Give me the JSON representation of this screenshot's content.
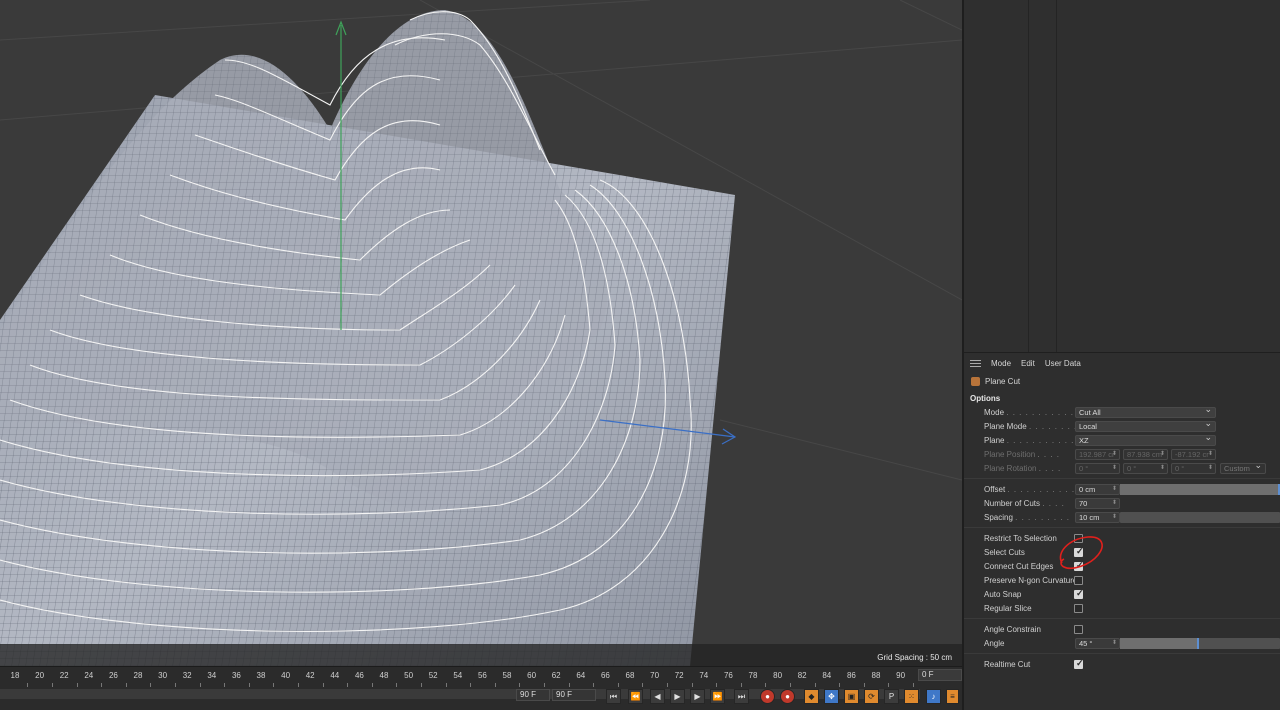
{
  "viewport": {
    "grid_spacing": "Grid Spacing : 50 cm"
  },
  "attributes": {
    "menu": [
      "Mode",
      "Edit",
      "User Data"
    ],
    "object_name": "Plane Cut",
    "section": "Options",
    "mode": {
      "label": "Mode",
      "value": "Cut All"
    },
    "plane_mode": {
      "label": "Plane Mode",
      "value": "Local"
    },
    "plane": {
      "label": "Plane",
      "value": "XZ"
    },
    "plane_position": {
      "label": "Plane Position",
      "values": [
        "192.987 cr",
        "87.938 cm",
        "-87.192 cr"
      ]
    },
    "plane_rotation": {
      "label": "Plane Rotation",
      "values": [
        "0 °",
        "0 °",
        "0 °"
      ],
      "mode": "Custom"
    },
    "offset": {
      "label": "Offset",
      "value": "0 cm",
      "slider": 0.99
    },
    "number_of_cuts": {
      "label": "Number of Cuts",
      "value": "70"
    },
    "spacing": {
      "label": "Spacing",
      "value": "10 cm",
      "slider": 0.0
    },
    "restrict_to_selection": {
      "label": "Restrict To Selection",
      "checked": false
    },
    "select_cuts": {
      "label": "Select Cuts",
      "checked": true
    },
    "connect_cut_edges": {
      "label": "Connect Cut Edges",
      "checked": true
    },
    "preserve_ngon": {
      "label": "Preserve N-gon Curvature",
      "checked": false
    },
    "auto_snap": {
      "label": "Auto Snap",
      "checked": true
    },
    "regular_slice": {
      "label": "Regular Slice",
      "checked": false
    },
    "angle_constrain": {
      "label": "Angle Constrain",
      "checked": false
    },
    "angle": {
      "label": "Angle",
      "value": "45 °",
      "slider": 0.5
    },
    "realtime_cut": {
      "label": "Realtime Cut",
      "checked": true
    }
  },
  "timeline": {
    "ticks": [
      "18",
      "20",
      "22",
      "24",
      "26",
      "28",
      "30",
      "32",
      "34",
      "36",
      "38",
      "40",
      "42",
      "44",
      "46",
      "48",
      "50",
      "52",
      "54",
      "56",
      "58",
      "60",
      "62",
      "64",
      "66",
      "68",
      "70",
      "72",
      "74",
      "76",
      "78",
      "80",
      "82",
      "84",
      "86",
      "88",
      "90"
    ],
    "current_frame": "0 F",
    "end_frame": "90 F",
    "end_frame_2": "90 F"
  },
  "colors": {
    "accent_blue": "#5d8fd1",
    "record_red": "#c0392b",
    "annotation_red": "#e0201c"
  }
}
